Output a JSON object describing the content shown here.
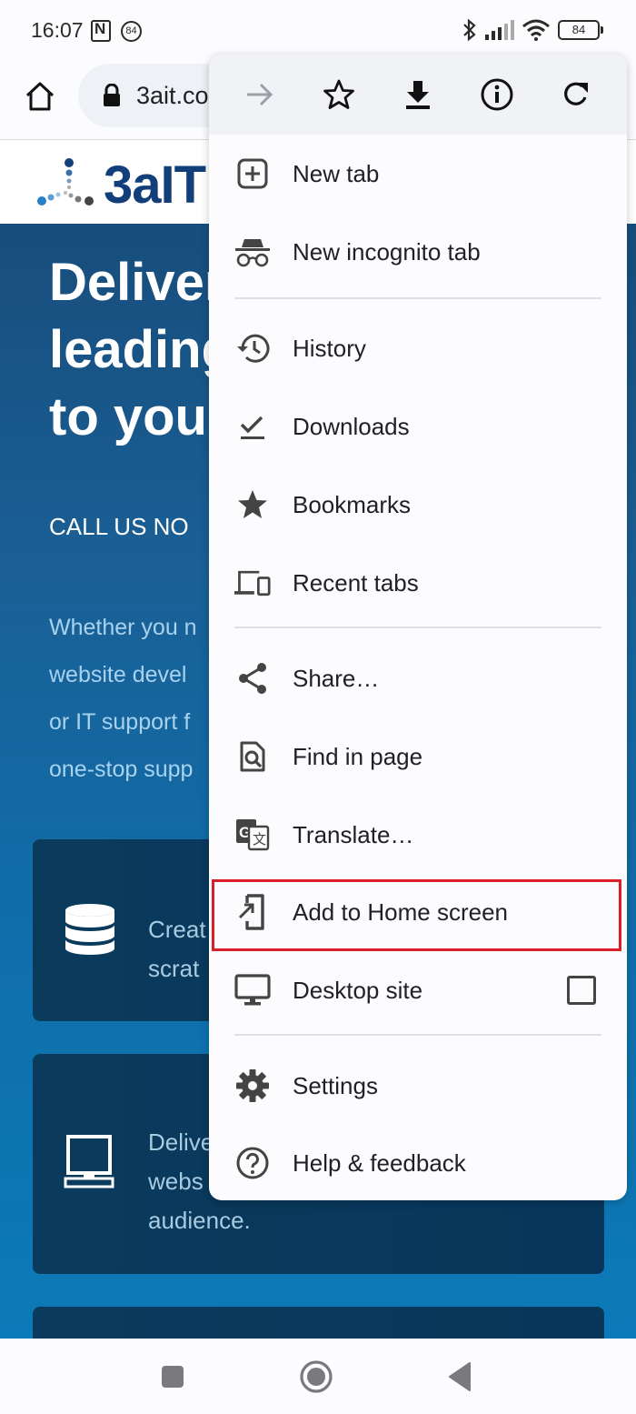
{
  "status_bar": {
    "time": "16:07",
    "notification_count": "84",
    "battery_level": "84"
  },
  "toolbar": {
    "url": "3ait.co",
    "icons": [
      "home-icon",
      "lock-icon"
    ]
  },
  "webpage": {
    "logo_text": "3aIT",
    "hero_title": "Deliver\nleading\nto you",
    "call_us": "CALL US NO",
    "description": "Whether you n\nwebsite devel\nor IT support f\none-stop supp",
    "cards": [
      {
        "icon": "database-icon",
        "text": "Creat\nscrat"
      },
      {
        "icon": "monitor-icon",
        "text": "Delive\nwebs\naudience."
      },
      {
        "icon": "",
        "text": ""
      }
    ]
  },
  "menu": {
    "top_actions": [
      {
        "name": "forward-icon",
        "enabled": false
      },
      {
        "name": "bookmark-star-icon",
        "enabled": true
      },
      {
        "name": "download-icon",
        "enabled": true
      },
      {
        "name": "page-info-icon",
        "enabled": true
      },
      {
        "name": "reload-icon",
        "enabled": true
      }
    ],
    "items": [
      {
        "label": "New tab",
        "icon": "new-tab-icon"
      },
      {
        "label": "New incognito tab",
        "icon": "incognito-icon"
      },
      {
        "label": "History",
        "icon": "history-icon"
      },
      {
        "label": "Downloads",
        "icon": "downloads-icon"
      },
      {
        "label": "Bookmarks",
        "icon": "bookmarks-icon"
      },
      {
        "label": "Recent tabs",
        "icon": "recent-tabs-icon"
      },
      {
        "label": "Share…",
        "icon": "share-icon"
      },
      {
        "label": "Find in page",
        "icon": "find-in-page-icon"
      },
      {
        "label": "Translate…",
        "icon": "translate-icon"
      },
      {
        "label": "Add to Home screen",
        "icon": "add-to-home-icon",
        "highlighted": true
      },
      {
        "label": "Desktop site",
        "icon": "desktop-icon",
        "checkbox": false
      },
      {
        "label": "Settings",
        "icon": "settings-icon"
      },
      {
        "label": "Help & feedback",
        "icon": "help-icon"
      }
    ]
  },
  "colors": {
    "highlight": "#d9202a",
    "hero_bg": "#1a5f95",
    "logo_blue": "#123f7a"
  }
}
